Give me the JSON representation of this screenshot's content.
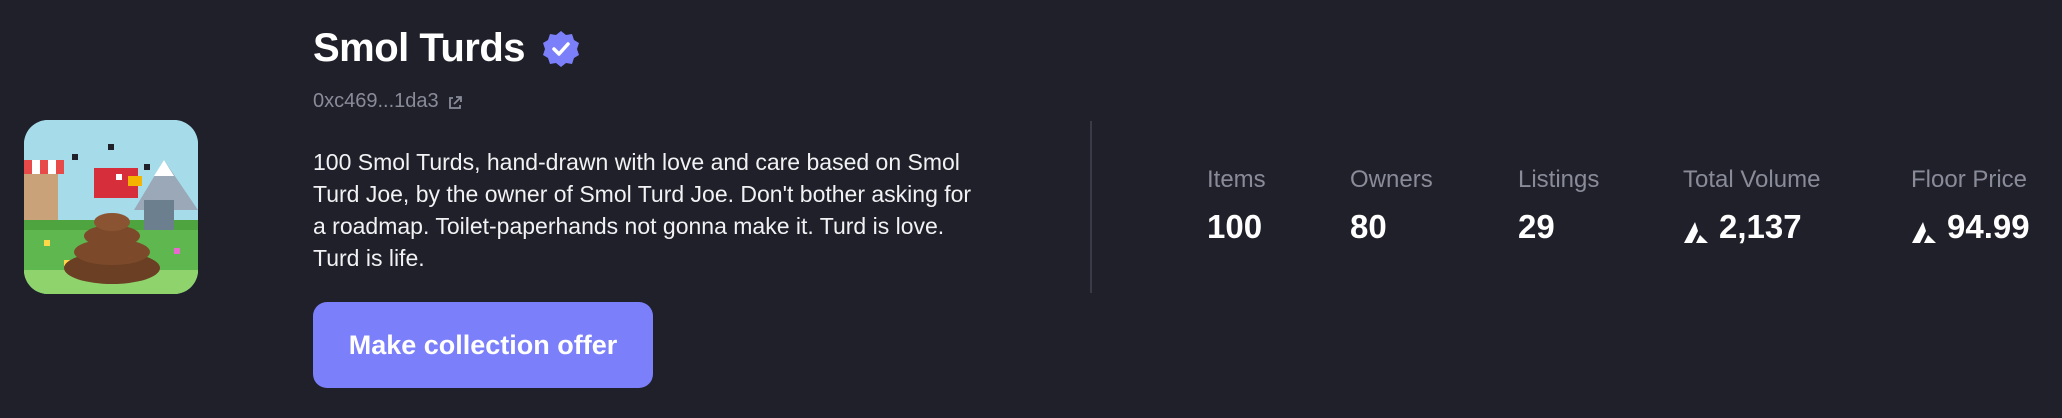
{
  "collection": {
    "name": "Smol Turds",
    "verified_icon": "verified-badge-icon",
    "address": "0xc469...1da3",
    "address_link_icon": "external-link-icon",
    "description": "100 Smol Turds, hand-drawn with love and care based on Smol Turd Joe, by the owner of Smol Turd Joe. Don't bother asking for a roadmap. Toilet-paperhands not gonna make it. Turd is love. Turd is life.",
    "offer_button_label": "Make collection offer"
  },
  "stats": {
    "items": {
      "label": "Items",
      "value": "100"
    },
    "owners": {
      "label": "Owners",
      "value": "80"
    },
    "listings": {
      "label": "Listings",
      "value": "29"
    },
    "total_volume": {
      "label": "Total Volume",
      "value": "2,137",
      "currency_icon": "avax-icon"
    },
    "floor_price": {
      "label": "Floor Price",
      "value": "94.99",
      "currency_icon": "avax-icon"
    }
  },
  "colors": {
    "background": "#1f2029",
    "accent": "#7b7ffa",
    "muted_text": "#8a8b99",
    "divider": "#3a3b47"
  }
}
